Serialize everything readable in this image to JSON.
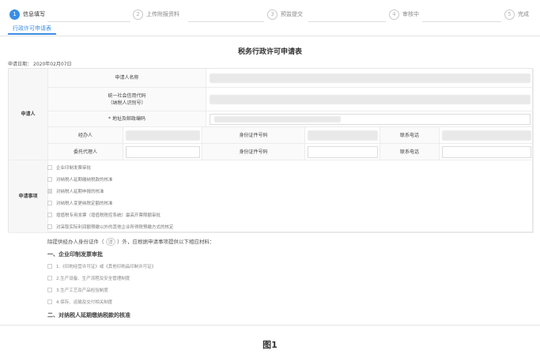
{
  "steps": [
    {
      "num": "1",
      "label": "信息填写"
    },
    {
      "num": "2",
      "label": "上传附报资料"
    },
    {
      "num": "3",
      "label": "预监提交"
    },
    {
      "num": "4",
      "label": "审核中"
    },
    {
      "num": "5",
      "label": "完成"
    }
  ],
  "subtab": "行政许可申请表",
  "form_title": "税务行政许可申请表",
  "apply_date_label": "申请日期：",
  "apply_date": "2020年02月07日",
  "applicant": {
    "section": "申请人",
    "name_label": "申请人名称",
    "credit_code_label": "统一社会信用代码",
    "taxpayer_id_label": "（纳税人识别号）",
    "address_label": "* 地址及邮政编码",
    "handler_label": "经办人",
    "id_number_label": "身份证件号码",
    "phone_label": "联系电话",
    "agent_label": "委托代理人",
    "id_number_label_2": "身份证件号码",
    "phone_label_2": "联系电话"
  },
  "matters": {
    "section": "申请事项",
    "items": [
      {
        "label": "企业印制发票审批",
        "checked": false
      },
      {
        "label": "对纳税人延期缴纳税款的核准",
        "checked": false
      },
      {
        "label": "对纳税人延期申报的核准",
        "checked": true
      },
      {
        "label": "对纳税人变更纳税定额的核准",
        "checked": false
      },
      {
        "label": "增值税专用发票（增值税税控系统）最高开票限额审批",
        "checked": false
      },
      {
        "label": "对采取实际利润额预缴以外的其他企业所得税预缴方式的核定",
        "checked": false
      }
    ]
  },
  "materials": {
    "intro_before": "除提供经办人身份证件（",
    "intro_tag": "详",
    "intro_after": "）外，应根据申请事项提供以下相应材料：",
    "head1": "一、企业印制发票审批",
    "items1": [
      "1.《印刷经营许可证》或《其他印刷品印制许可证》",
      "2.生产设备、生产流程及安全管理制度",
      "3.生产工艺及产品检验制度",
      "4.保存、运输及交付相关制度"
    ],
    "head2": "二、对纳税人延期缴纳税款的核准"
  },
  "caption": "图1"
}
